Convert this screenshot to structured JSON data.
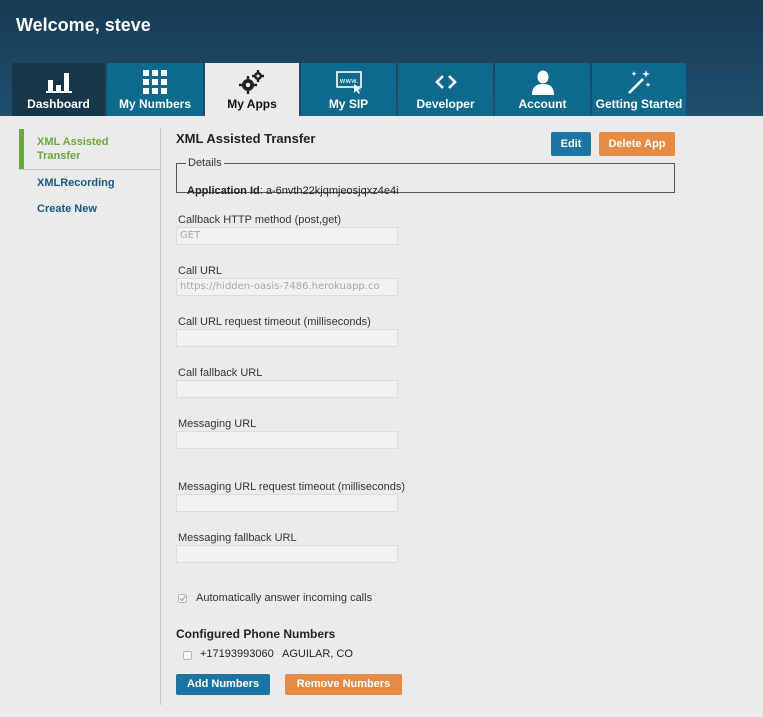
{
  "header": {
    "welcome": "Welcome, steve"
  },
  "tabs": [
    {
      "label": "Dashboard",
      "icon": "bar-chart-icon"
    },
    {
      "label": "My Numbers",
      "icon": "keypad-icon"
    },
    {
      "label": "My Apps",
      "icon": "gears-icon"
    },
    {
      "label": "My SIP",
      "icon": "www-icon"
    },
    {
      "label": "Developer",
      "icon": "code-icon"
    },
    {
      "label": "Account",
      "icon": "user-icon"
    },
    {
      "label": "Getting Started",
      "icon": "magic-wand-icon"
    }
  ],
  "sidebar": {
    "items": [
      {
        "label": "XML Assisted Transfer",
        "line1": "XML Assisted",
        "line2": "Transfer"
      },
      {
        "label": "XMLRecording"
      },
      {
        "label": "Create New"
      }
    ]
  },
  "app": {
    "title": "XML Assisted Transfer",
    "edit_label": "Edit",
    "delete_label": "Delete App",
    "details_legend": "Details",
    "app_id_label": "Application Id",
    "app_id_value": ": a-6nvth22kjqmjeosjqxz4e4i"
  },
  "form": {
    "fields": [
      {
        "label": "Callback HTTP method (post,get)",
        "value": "GET"
      },
      {
        "label": "Call URL",
        "value": "https://hidden-oasis-7486.herokuapp.co"
      },
      {
        "label": "Call URL request timeout (milliseconds)",
        "value": ""
      },
      {
        "label": "Call fallback URL",
        "value": ""
      },
      {
        "label": "Messaging URL",
        "value": ""
      },
      {
        "label": "Messaging URL request timeout (milliseconds)",
        "value": ""
      },
      {
        "label": "Messaging fallback URL",
        "value": ""
      }
    ],
    "auto_answer_label": "Automatically answer incoming calls"
  },
  "numbers": {
    "heading": "Configured Phone Numbers",
    "items": [
      {
        "number": "+17193993060",
        "location": "AGUILAR, CO"
      }
    ],
    "add_label": "Add Numbers",
    "remove_label": "Remove Numbers"
  },
  "colors": {
    "header": "#1f4f6e",
    "tab": "#0e6a8d",
    "active_side": "#6aa83b",
    "link": "#155a80",
    "blue_btn": "#1c74a3",
    "orange_btn": "#e68b44"
  }
}
